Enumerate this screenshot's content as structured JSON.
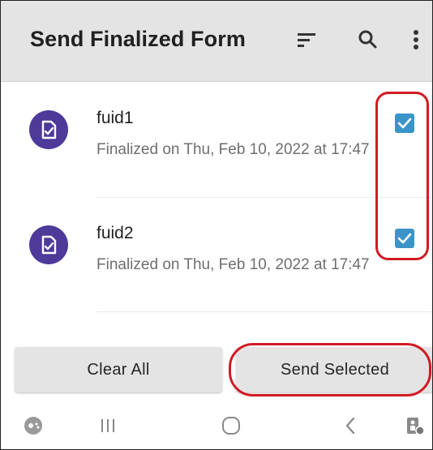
{
  "app_bar": {
    "title": "Send Finalized Form",
    "icons": [
      "sort-icon",
      "search-icon",
      "more-vert-icon"
    ]
  },
  "forms": [
    {
      "name": "fuid1",
      "status": "Finalized on Thu, Feb 10, 2022 at 17:47",
      "checked": true
    },
    {
      "name": "fuid2",
      "status": "Finalized on Thu, Feb 10, 2022 at 17:47",
      "checked": true
    }
  ],
  "buttons": {
    "clear_all": "Clear All",
    "send_selected": "Send Selected"
  },
  "nav_bar": {
    "icons": [
      "game-launcher-icon",
      "recents-icon",
      "home-icon",
      "back-icon",
      "accessibility-icon"
    ]
  },
  "colors": {
    "app_bar": "#e4e4e4",
    "avatar": "#4d3a99",
    "checkbox": "#3b94c8",
    "annotation": "#d21a24"
  }
}
